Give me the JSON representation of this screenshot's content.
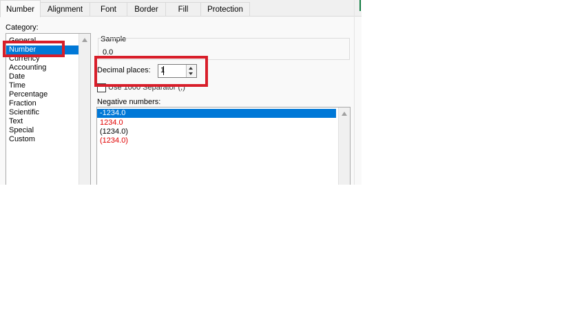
{
  "tabs": [
    "Number",
    "Alignment",
    "Font",
    "Border",
    "Fill",
    "Protection"
  ],
  "category": {
    "label": "Category:",
    "items": [
      "General",
      "Number",
      "Currency",
      "Accounting",
      "Date",
      "Time",
      "Percentage",
      "Fraction",
      "Scientific",
      "Text",
      "Special",
      "Custom"
    ],
    "selected": "Number"
  },
  "sample": {
    "label": "Sample",
    "value": "0.0"
  },
  "decimal_places": {
    "label": "Decimal places:",
    "value": "1"
  },
  "thousands_separator": {
    "label": "Use 1000 Separator (,)"
  },
  "negative_numbers": {
    "label": "Negative numbers:",
    "items": [
      "-1234.0",
      "1234.0",
      "(1234.0)",
      "(1234.0)"
    ],
    "red_color": "#e00000"
  },
  "colors": {
    "selection": "#0078d7",
    "highlight": "#d81e2a",
    "accent": "#107c41"
  }
}
